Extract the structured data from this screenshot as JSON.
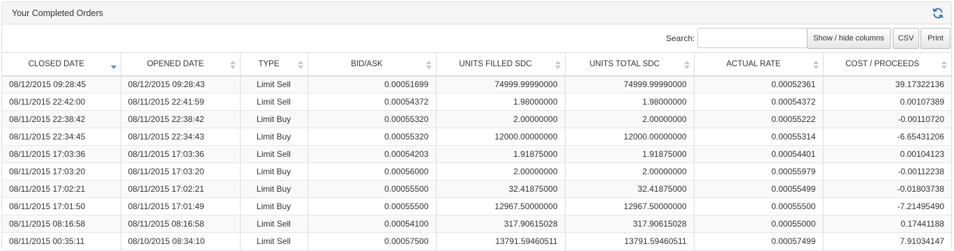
{
  "panel": {
    "title": "Your Completed Orders",
    "refresh_icon": "refresh-icon"
  },
  "toolbar": {
    "search_label": "Search:",
    "search_value": "",
    "show_hide_label": "Show / hide columns",
    "csv_label": "CSV",
    "print_label": "Print"
  },
  "table": {
    "columns": [
      {
        "label": "CLOSED DATE",
        "sort": "desc",
        "align": "left"
      },
      {
        "label": "OPENED DATE",
        "sort": "none",
        "align": "left"
      },
      {
        "label": "TYPE",
        "sort": "none",
        "align": "center"
      },
      {
        "label": "BID/ASK",
        "sort": "none",
        "align": "right"
      },
      {
        "label": "UNITS FILLED SDC",
        "sort": "none",
        "align": "right"
      },
      {
        "label": "UNITS TOTAL SDC",
        "sort": "none",
        "align": "right"
      },
      {
        "label": "ACTUAL RATE",
        "sort": "none",
        "align": "right"
      },
      {
        "label": "COST / PROCEEDS",
        "sort": "none",
        "align": "right"
      }
    ],
    "rows": [
      [
        "08/12/2015 09:28:45",
        "08/12/2015 09:28:43",
        "Limit Sell",
        "0.00051699",
        "74999.99990000",
        "74999.99990000",
        "0.00052361",
        "39.17322136"
      ],
      [
        "08/11/2015 22:42:00",
        "08/11/2015 22:41:59",
        "Limit Sell",
        "0.00054372",
        "1.98000000",
        "1.98000000",
        "0.00054372",
        "0.00107389"
      ],
      [
        "08/11/2015 22:38:42",
        "08/11/2015 22:38:42",
        "Limit Buy",
        "0.00055320",
        "2.00000000",
        "2.00000000",
        "0.00055222",
        "-0.00110720"
      ],
      [
        "08/11/2015 22:34:45",
        "08/11/2015 22:34:43",
        "Limit Buy",
        "0.00055320",
        "12000.00000000",
        "12000.00000000",
        "0.00055314",
        "-6.65431206"
      ],
      [
        "08/11/2015 17:03:36",
        "08/11/2015 17:03:36",
        "Limit Sell",
        "0.00054203",
        "1.91875000",
        "1.91875000",
        "0.00054401",
        "0.00104123"
      ],
      [
        "08/11/2015 17:03:20",
        "08/11/2015 17:03:20",
        "Limit Buy",
        "0.00056000",
        "2.00000000",
        "2.00000000",
        "0.00055979",
        "-0.00112238"
      ],
      [
        "08/11/2015 17:02:21",
        "08/11/2015 17:02:21",
        "Limit Buy",
        "0.00055500",
        "32.41875000",
        "32.41875000",
        "0.00055499",
        "-0.01803738"
      ],
      [
        "08/11/2015 17:01:50",
        "08/11/2015 17:01:49",
        "Limit Buy",
        "0.00055500",
        "12967.50000000",
        "12967.50000000",
        "0.00055500",
        "-7.21495490"
      ],
      [
        "08/11/2015 08:16:58",
        "08/11/2015 08:16:58",
        "Limit Sell",
        "0.00054100",
        "317.90615028",
        "317.90615028",
        "0.00055000",
        "0.17441188"
      ],
      [
        "08/11/2015 00:35:11",
        "08/10/2015 08:34:10",
        "Limit Sell",
        "0.00057500",
        "13791.59460511",
        "13791.59460511",
        "0.00057499",
        "7.91034147"
      ]
    ]
  },
  "colors": {
    "refresh": "#337ab7",
    "sort_active": "#6f7fc6",
    "sort_inactive": "#c8c8c8",
    "heading_bg": "#f5f5f5"
  }
}
